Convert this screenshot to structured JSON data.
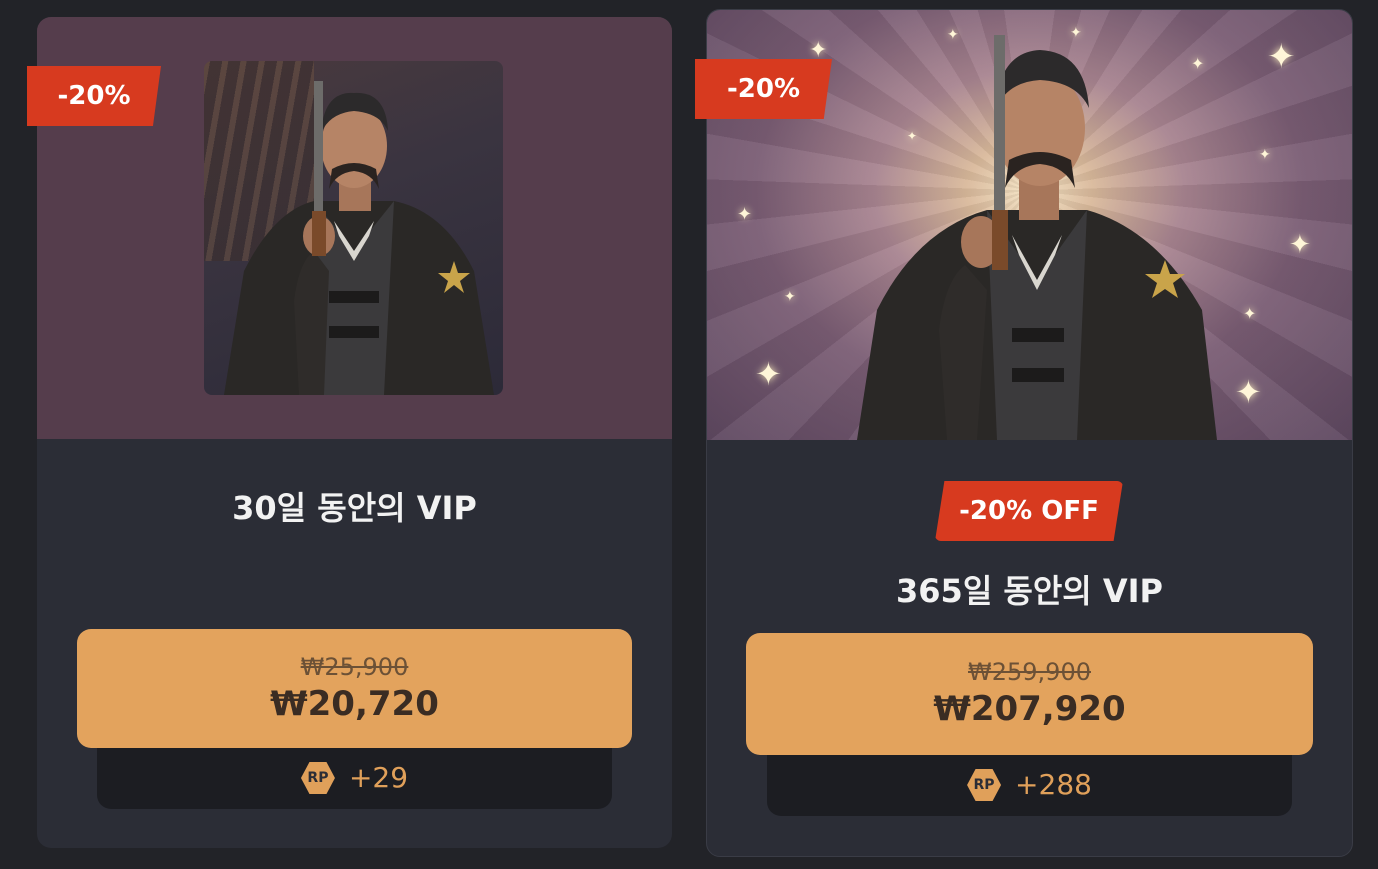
{
  "products": [
    {
      "discount_tag": "-20%",
      "title": "30일 동안의 VIP",
      "old_price": "₩25,900",
      "new_price": "₩20,720",
      "rp_icon_label": "RP",
      "rp_amount": "+29"
    },
    {
      "discount_tag": "-20%",
      "off_badge": "-20% OFF",
      "title": "365일 동안의 VIP",
      "old_price": "₩259,900",
      "new_price": "₩207,920",
      "rp_icon_label": "RP",
      "rp_amount": "+288"
    }
  ],
  "colors": {
    "background": "#222328",
    "card": "#2b2d36",
    "sale_red": "#d73a1f",
    "price_button": "#e3a35d",
    "rp_gold": "#e0a05a"
  },
  "icons": [
    "sheriff-portrait-image",
    "sparkle-star-icon",
    "rp-coin-icon"
  ]
}
